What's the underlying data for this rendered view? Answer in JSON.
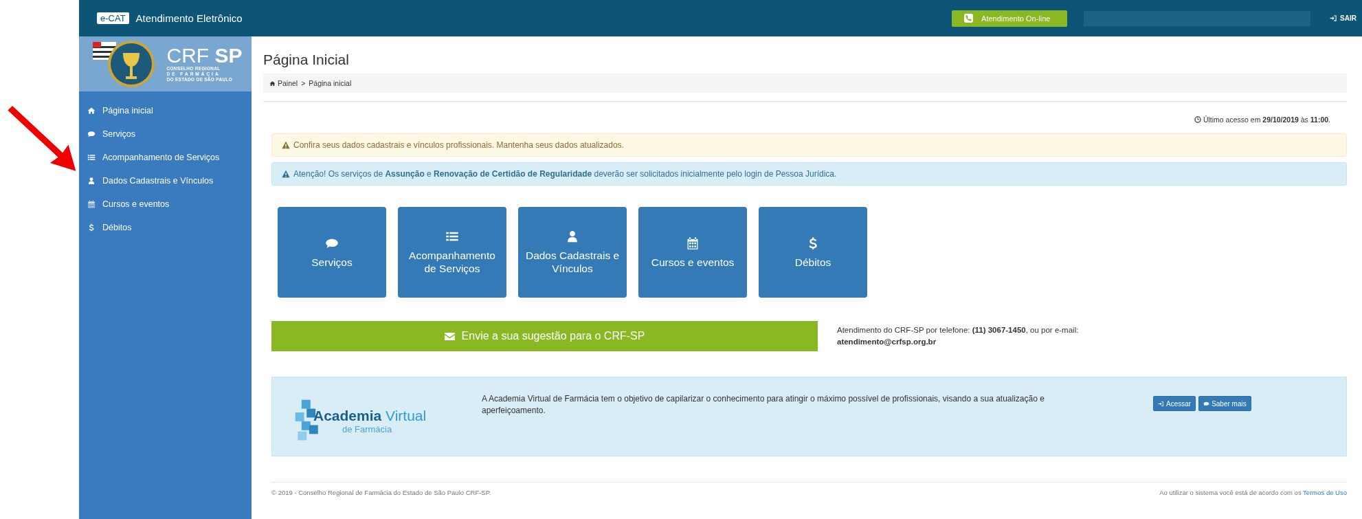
{
  "topbar": {
    "badge": "e-CAT",
    "title": "Atendimento Eletrônico",
    "online_button": "Atendimento On-line",
    "logout": "SAIR"
  },
  "logo": {
    "name_a": "CRF",
    "name_b": "SP",
    "line1": "CONSELHO REGIONAL",
    "line2": "DE FARMÁCIA",
    "line3": "DO ESTADO DE SÃO PAULO"
  },
  "sidebar": {
    "items": [
      {
        "kind": "home",
        "label": "Página inicial"
      },
      {
        "kind": "comment",
        "label": "Serviços"
      },
      {
        "kind": "list",
        "label": "Acompanhamento de Serviços"
      },
      {
        "kind": "user",
        "label": "Dados Cadastrais e Vínculos"
      },
      {
        "kind": "calendar",
        "label": "Cursos e eventos"
      },
      {
        "kind": "dollar",
        "label": "Débitos"
      }
    ]
  },
  "page": {
    "title": "Página Inicial",
    "breadcrumb": [
      "Painel",
      "Página inicial"
    ],
    "breadcrumb_separator": ">",
    "last_access": "Último acesso em **29/10/2019** às **11:00**."
  },
  "alerts": [
    {
      "kind": "warning",
      "text": "Confira seus dados cadastrais e vínculos profissionais. Mantenha seus dados atualizados."
    },
    {
      "kind": "info",
      "text": "Atenção! Os serviços de **Assunção** e **Renovação de Certidão de Regularidade** deverão ser solicitados inicialmente pelo login de Pessoa Jurídica."
    }
  ],
  "tiles": [
    {
      "kind": "comment",
      "label": "Serviços"
    },
    {
      "kind": "list",
      "label": "Acompanhamento de Serviços"
    },
    {
      "kind": "user",
      "label": "Dados Cadastrais e Vínculos"
    },
    {
      "kind": "calendar",
      "label": "Cursos e eventos"
    },
    {
      "kind": "dollar",
      "label": "Débitos"
    }
  ],
  "suggestion_button": "Envie a sua sugestão para o CRF-SP",
  "contact": {
    "text": "Atendimento do CRF-SP por telefone: **(11) 3067-1450**, ou por e-mail:",
    "email": "atendimento@crfsp.org.br"
  },
  "academy": {
    "logo_a": "Academia",
    "logo_b": "Virtual",
    "logo_c": "de Farmácia",
    "text": "A Academia Virtual de Farmácia tem o objetivo de capilarizar o conhecimento para atingir o máximo possível de profissionais, visando a sua atualização e aperfeiçoamento.",
    "buttons": [
      {
        "kind": "sign-in",
        "label": "Acessar"
      },
      {
        "kind": "comment",
        "label": "Saber mais"
      }
    ]
  },
  "footer": {
    "copyright": "© 2019 - Conselho Regional de Farmácia do Estado de São Paulo CRF-SP.",
    "terms_text": "Ao utilizar o sistema você está de acordo com os",
    "terms_link": "Termos de Uso"
  }
}
